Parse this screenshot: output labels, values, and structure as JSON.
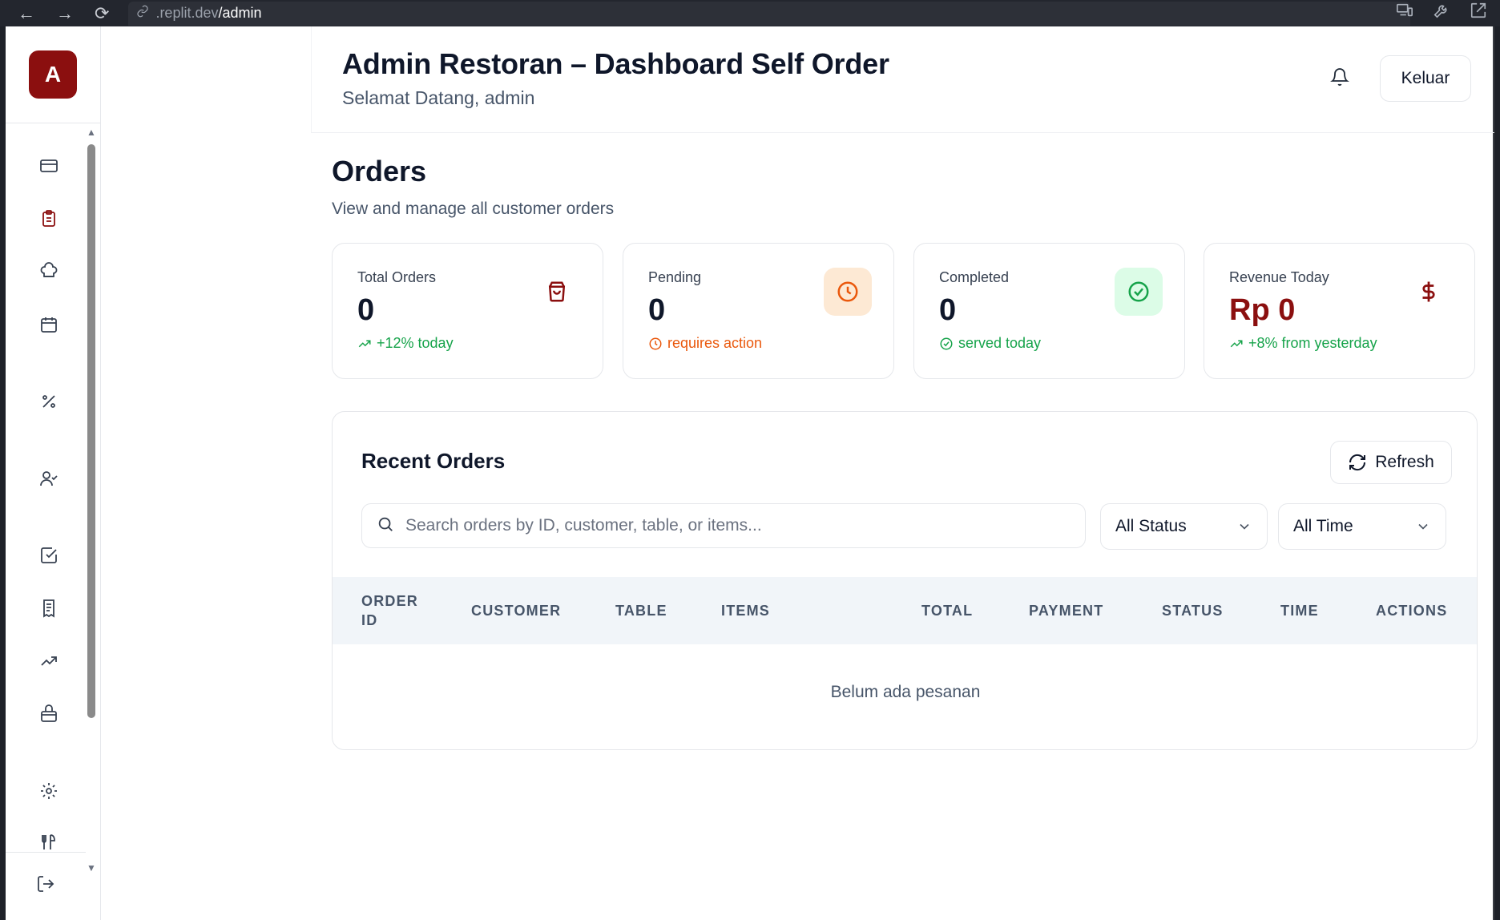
{
  "browser": {
    "url_host": ".replit.dev",
    "url_path": "/admin"
  },
  "app": {
    "logo_letter": "A",
    "title": "Admin Restoran – Dashboard Self Order",
    "welcome": "Selamat Datang, admin",
    "logout_label": "Keluar"
  },
  "sidebar": {
    "items": [
      {
        "icon": "credit-card-icon",
        "active": false
      },
      {
        "icon": "clipboard-list-icon",
        "active": true
      },
      {
        "icon": "chef-hat-icon",
        "active": false
      },
      {
        "icon": "calendar-icon",
        "active": false
      },
      {
        "icon": "percent-icon",
        "active": false
      },
      {
        "icon": "user-check-icon",
        "active": false
      },
      {
        "icon": "square-check-icon",
        "active": false
      },
      {
        "icon": "receipt-icon",
        "active": false
      },
      {
        "icon": "trending-up-icon",
        "active": false
      },
      {
        "icon": "store-icon",
        "active": false
      },
      {
        "icon": "settings-icon",
        "active": false
      },
      {
        "icon": "utensils-icon",
        "active": false
      }
    ],
    "accent_color": "#8b0f0f"
  },
  "page": {
    "title": "Orders",
    "subtitle": "View and manage all customer orders"
  },
  "stats": [
    {
      "label": "Total Orders",
      "value": "0",
      "note": "+12% today",
      "note_color": "#16a34a",
      "icon": "shopping-bag-icon"
    },
    {
      "label": "Pending",
      "value": "0",
      "note": "requires action",
      "note_color": "#ea580c",
      "icon": "clock-icon"
    },
    {
      "label": "Completed",
      "value": "0",
      "note": "served today",
      "note_color": "#16a34a",
      "icon": "check-circle-icon"
    },
    {
      "label": "Revenue Today",
      "value": "Rp 0",
      "note": "+8% from yesterday",
      "note_color": "#16a34a",
      "icon": "dollar-icon"
    }
  ],
  "recent_orders": {
    "title": "Recent Orders",
    "refresh_label": "Refresh",
    "search_placeholder": "Search orders by ID, customer, table, or items...",
    "status_filter": "All Status",
    "time_filter": "All Time",
    "columns": [
      "ORDER ID",
      "CUSTOMER",
      "TABLE",
      "ITEMS",
      "TOTAL",
      "PAYMENT",
      "STATUS",
      "TIME",
      "ACTIONS"
    ],
    "column_line1": "ORDER",
    "column_line2": "ID",
    "empty_message": "Belum ada pesanan"
  }
}
